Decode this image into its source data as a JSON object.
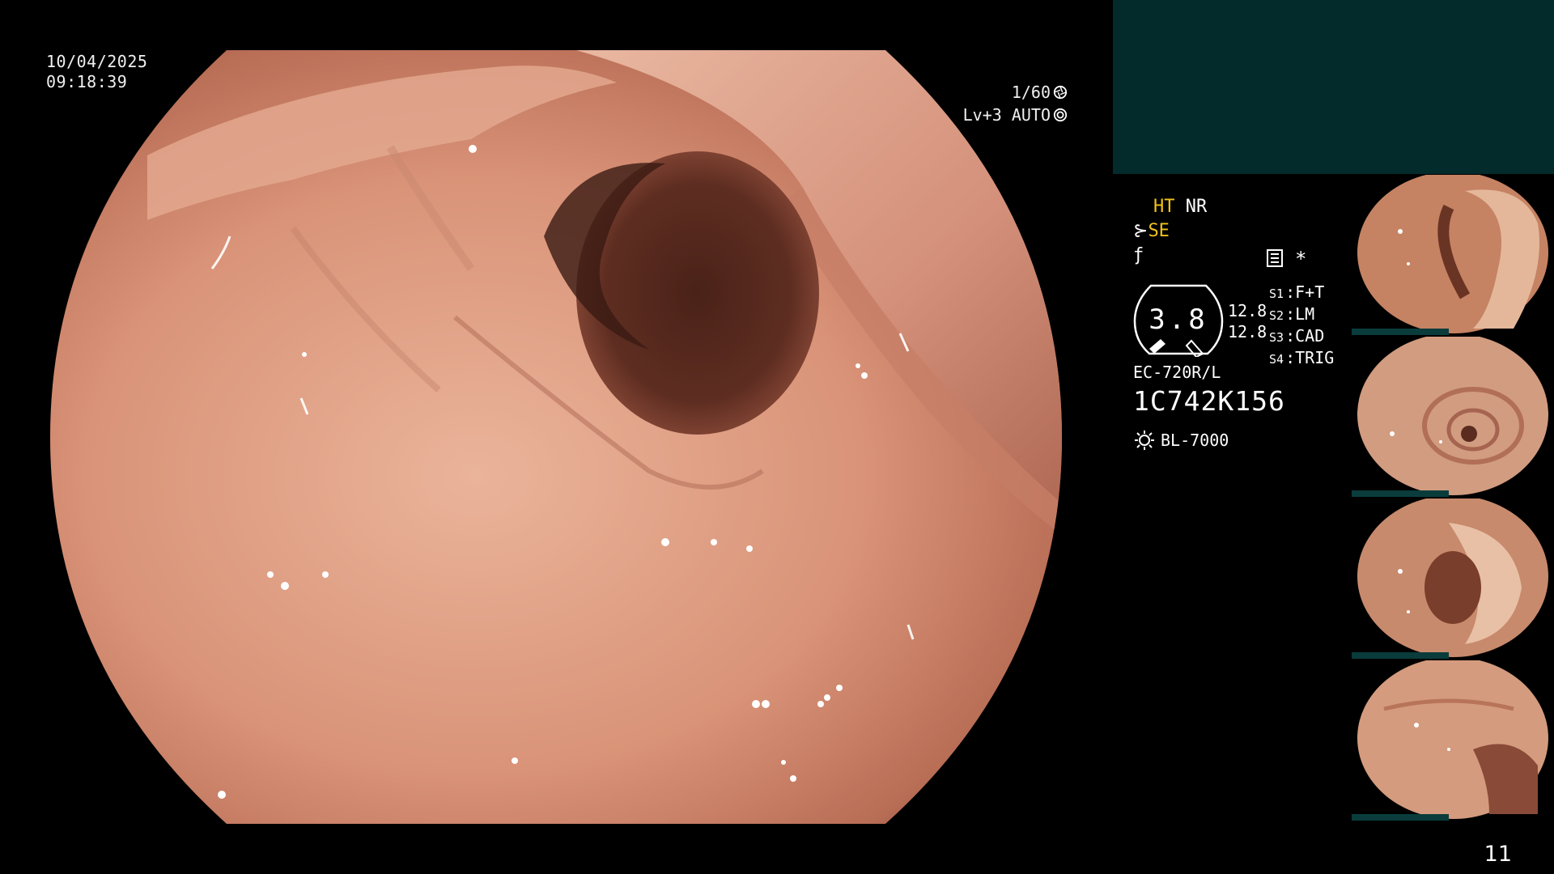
{
  "datetime": {
    "date": "10/04/2025",
    "time": "09:18:39"
  },
  "exposure": {
    "shutter": "1/60",
    "level": "Lv+3 AUTO",
    "shutter_icon": "aperture-icon",
    "auto_icon": "iris-icon"
  },
  "status": {
    "ht": "HT",
    "nr": "NR",
    "se": "SE",
    "se_icon": "scope-angle-icon",
    "f_icon": "f-symbol-icon",
    "memo_icon": "memo-icon",
    "star": "*"
  },
  "gauge": {
    "value": "3.8",
    "upper": "12.8",
    "lower": "12.8"
  },
  "switches": [
    {
      "key": "S1",
      "value": "F+T"
    },
    {
      "key": "S2",
      "value": "LM"
    },
    {
      "key": "S3",
      "value": "CAD"
    },
    {
      "key": "S4",
      "value": "TRIG"
    }
  ],
  "scope_model": "EC-720R/L",
  "serial_number": "1C742K156",
  "light_source": "BL-7000",
  "colors": {
    "panel_teal": "#032b2b",
    "highlight_yellow": "#f1c21b",
    "mucosa": "#d9967a"
  },
  "page_number": "11"
}
